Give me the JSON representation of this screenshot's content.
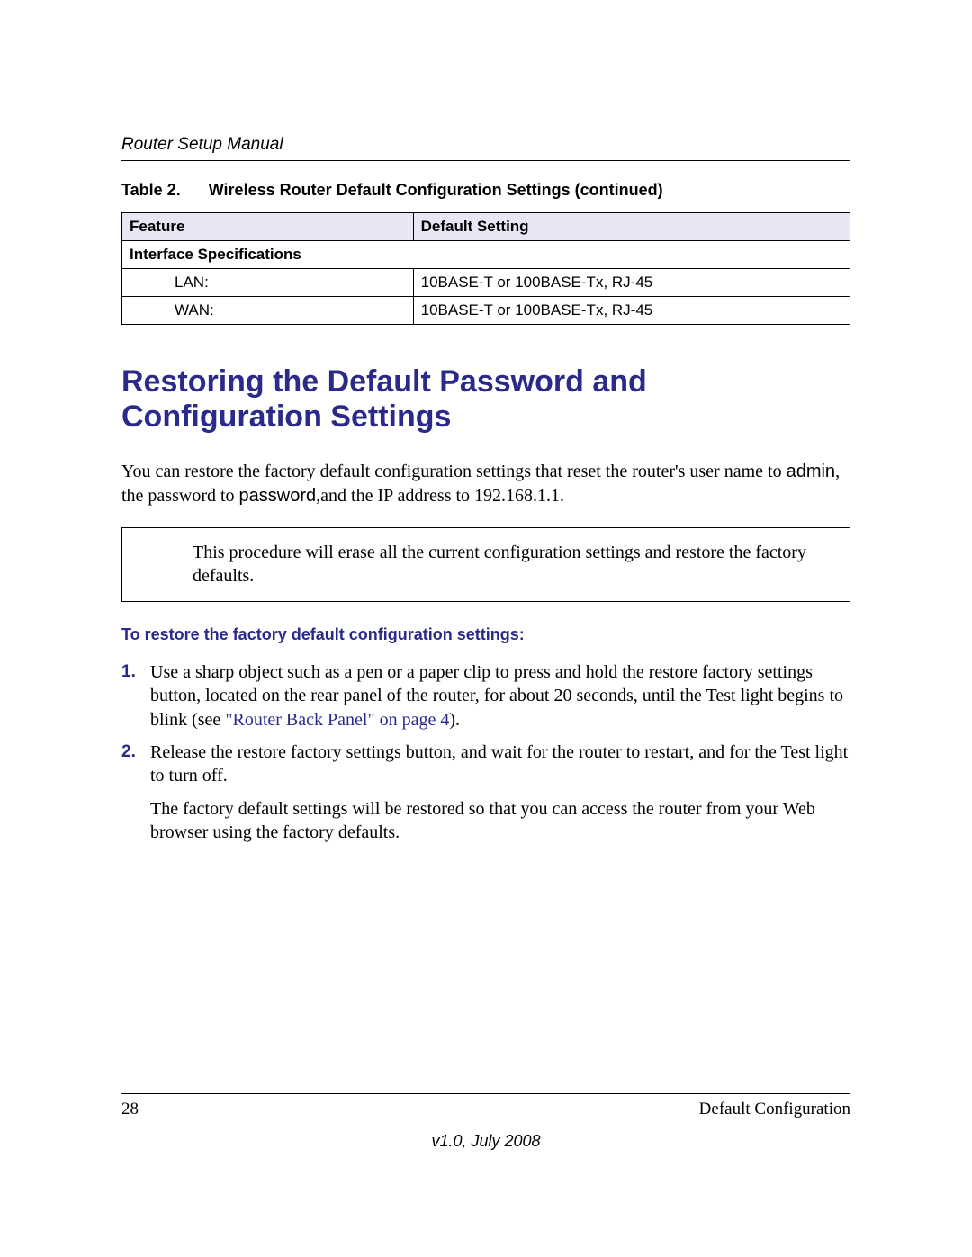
{
  "header": {
    "running_title": "Router Setup Manual"
  },
  "table": {
    "caption_label": "Table 2.",
    "caption_title": "Wireless Router Default Configuration Settings (continued)",
    "col_feature": "Feature",
    "col_default": "Default Setting",
    "section_row": "Interface Specifications",
    "rows": [
      {
        "feature": "LAN:",
        "value": "10BASE-T or 100BASE-Tx, RJ-45"
      },
      {
        "feature": "WAN:",
        "value": "10BASE-T or 100BASE-Tx, RJ-45"
      }
    ]
  },
  "section": {
    "heading": "Restoring the Default Password and Configuration Settings",
    "intro_part1": "You can restore the factory default configuration settings that reset the router's user name to ",
    "intro_admin": "admin",
    "intro_part2": ", the password to ",
    "intro_password": "password",
    "intro_part3": ",and the IP address to 192.168.1.1.",
    "note": "This procedure will erase all the current configuration settings and restore the factory defaults.",
    "sub_heading": "To restore the factory default configuration settings:",
    "steps": {
      "s1_a": "Use a sharp object such as a pen or a paper clip to press and hold the restore factory settings button, located on the rear panel of the router, for about 20 seconds, until the Test light begins to blink (see ",
      "s1_link": "\"Router Back Panel\" on page 4",
      "s1_b": ").",
      "s2": "Release the restore factory settings button, and wait for the router to restart, and for the Test light to turn off."
    },
    "after_list": "The factory default settings will be restored so that you can access the router from your Web browser using the factory defaults."
  },
  "footer": {
    "page_number": "28",
    "section_name": "Default Configuration",
    "version": "v1.0, July 2008"
  }
}
